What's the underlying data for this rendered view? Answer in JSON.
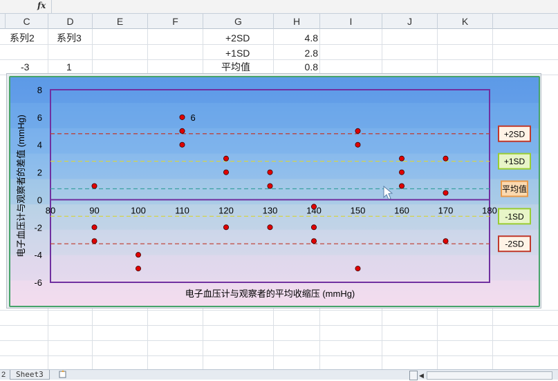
{
  "formula_bar": {
    "fx_label": "fx"
  },
  "columns": [
    "C",
    "D",
    "E",
    "F",
    "G",
    "H",
    "I",
    "J",
    "K"
  ],
  "cells": {
    "c_row1": "系列2",
    "d_row1": "系列3",
    "g_row1": "+2SD",
    "h_row1": "4.8",
    "g_row2": "+1SD",
    "h_row2": "2.8",
    "c_row3": "-3",
    "d_row3": "1",
    "g_row3": "平均值",
    "h_row3": "0.8"
  },
  "sheet_tabs": {
    "left_text": "2",
    "active_tab": "Sheet3"
  },
  "colors": {
    "plot_border": "#7030a0",
    "marker": "#e00000",
    "chart_border": "#46a36a"
  },
  "chart_data": {
    "type": "scatter",
    "title": "",
    "xlabel": "电子血压计与观察者的平均收缩压 (mmHg)",
    "ylabel": "电子血压计与观察者的差值 (mmHg)",
    "xlim": [
      80,
      180
    ],
    "ylim": [
      -6,
      8
    ],
    "xticks": [
      80,
      90,
      100,
      110,
      120,
      130,
      140,
      150,
      160,
      170,
      180
    ],
    "yticks": [
      -6,
      -4,
      -2,
      0,
      2,
      4,
      6,
      8
    ],
    "points": [
      {
        "x": 90,
        "y": 1
      },
      {
        "x": 90,
        "y": -2
      },
      {
        "x": 90,
        "y": -3
      },
      {
        "x": 100,
        "y": -4
      },
      {
        "x": 100,
        "y": -5
      },
      {
        "x": 110,
        "y": 6
      },
      {
        "x": 110,
        "y": 5
      },
      {
        "x": 110,
        "y": 4
      },
      {
        "x": 120,
        "y": 3
      },
      {
        "x": 120,
        "y": 2
      },
      {
        "x": 120,
        "y": -2
      },
      {
        "x": 130,
        "y": 2
      },
      {
        "x": 130,
        "y": 1
      },
      {
        "x": 130,
        "y": -2
      },
      {
        "x": 140,
        "y": -0.5
      },
      {
        "x": 140,
        "y": -2
      },
      {
        "x": 140,
        "y": -3
      },
      {
        "x": 150,
        "y": 5
      },
      {
        "x": 150,
        "y": 4
      },
      {
        "x": 150,
        "y": -5
      },
      {
        "x": 160,
        "y": 3
      },
      {
        "x": 160,
        "y": 2
      },
      {
        "x": 160,
        "y": 1
      },
      {
        "x": 170,
        "y": 3
      },
      {
        "x": 170,
        "y": 0.5
      },
      {
        "x": 170,
        "y": -3
      }
    ],
    "data_label": {
      "x": 110,
      "y": 6,
      "text": "6"
    },
    "reference_lines": [
      {
        "name": "+2SD",
        "y": 4.8,
        "color": "#c0392b",
        "box_border": "#c0392b",
        "box_fill": "#fff3e6"
      },
      {
        "name": "+1SD",
        "y": 2.8,
        "color": "#d4d44a",
        "box_border": "#9acd32",
        "box_fill": "#e8f5c8"
      },
      {
        "name": "平均值",
        "y": 0.8,
        "color": "#3aa0a0",
        "box_border": "#e89a4a",
        "box_fill": "#fbd9b0"
      },
      {
        "name": "-1SD",
        "y": -1.2,
        "color": "#d4d44a",
        "box_border": "#9acd32",
        "box_fill": "#e8f5c8"
      },
      {
        "name": "-2SD",
        "y": -3.2,
        "color": "#c0392b",
        "box_border": "#c0392b",
        "box_fill": "#fff3e6"
      }
    ]
  }
}
